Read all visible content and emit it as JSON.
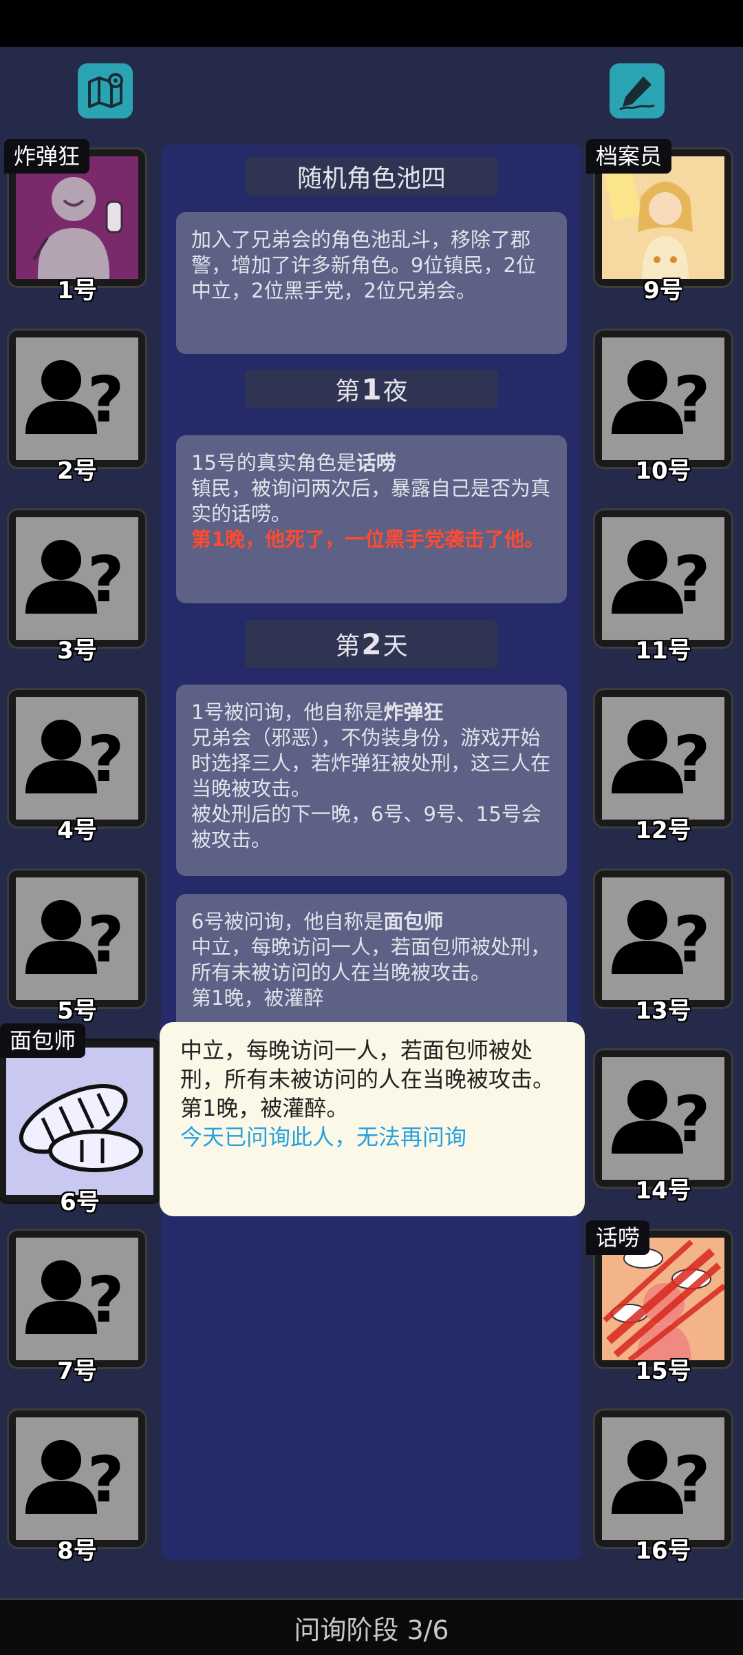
{
  "toolbar": {
    "left_icon": "map-pin-icon",
    "right_icon": "pen-icon"
  },
  "center": {
    "pool_title": "随机角色池四",
    "pool_desc": "加入了兄弟会的角色池乱斗，移除了郡警，增加了许多新角色。9位镇民，2位中立，2位黑手党，2位兄弟会。",
    "night1": {
      "prefix": "第",
      "num": "1",
      "suffix": "夜"
    },
    "entry15": {
      "intro": "15号的真实角色是",
      "role": "话唠",
      "desc": "镇民，被询问两次后，暴露自己是否为真实的话唠。",
      "death": "第1晚，他死了，一位黑手党袭击了他。"
    },
    "day2": {
      "prefix": "第",
      "num": "2",
      "suffix": "天"
    },
    "entry1": {
      "intro": "1号被问询，他自称是",
      "role": "炸弹狂",
      "desc": "兄弟会（邪恶），不伪装身份，游戏开始时选择三人，若炸弹狂被处刑，这三人在当晚被攻击。",
      "extra": "被处刑后的下一晚，6号、9号、15号会被攻击。"
    },
    "entry6": {
      "intro": "6号被问询，他自称是",
      "role": "面包师",
      "desc": "中立，每晚访问一人，若面包师被处刑，所有未被访问的人在当晚被攻击。",
      "tail": "第1晚，被灌醉"
    }
  },
  "popup": {
    "desc": "中立，每晚访问一人，若面包师被处刑，所有未被访问的人在当晚被攻击。",
    "night": "第1晚，被灌醉。",
    "notice": "今天已问询此人，无法再问询"
  },
  "players_left": [
    {
      "num": "1号",
      "role": "炸弹狂",
      "art": "bomber-portrait"
    },
    {
      "num": "2号",
      "art": "unknown-player-icon"
    },
    {
      "num": "3号",
      "art": "unknown-player-icon"
    },
    {
      "num": "4号",
      "art": "unknown-player-icon"
    },
    {
      "num": "5号",
      "art": "unknown-player-icon"
    },
    {
      "num": "6号",
      "role": "面包师",
      "art": "bread-icon"
    },
    {
      "num": "7号",
      "art": "unknown-player-icon"
    },
    {
      "num": "8号",
      "art": "unknown-player-icon"
    }
  ],
  "players_right": [
    {
      "num": "9号",
      "role": "档案员",
      "art": "archivist-portrait"
    },
    {
      "num": "10号",
      "art": "unknown-player-icon"
    },
    {
      "num": "11号",
      "art": "unknown-player-icon"
    },
    {
      "num": "12号",
      "art": "unknown-player-icon"
    },
    {
      "num": "13号",
      "art": "unknown-player-icon"
    },
    {
      "num": "14号",
      "art": "unknown-player-icon"
    },
    {
      "num": "15号",
      "role": "话唠",
      "art": "chatterbox-portrait-dead"
    },
    {
      "num": "16号",
      "art": "unknown-player-icon"
    }
  ],
  "status": {
    "phase": "问询阶段 3/6"
  },
  "colors": {
    "background": "#262a4a",
    "panel": "#252b69",
    "log_bubble": "#5c6185",
    "death_text": "#ff4a30",
    "notice_text": "#26a0e0",
    "icon_teal": "#2aa3b3"
  }
}
